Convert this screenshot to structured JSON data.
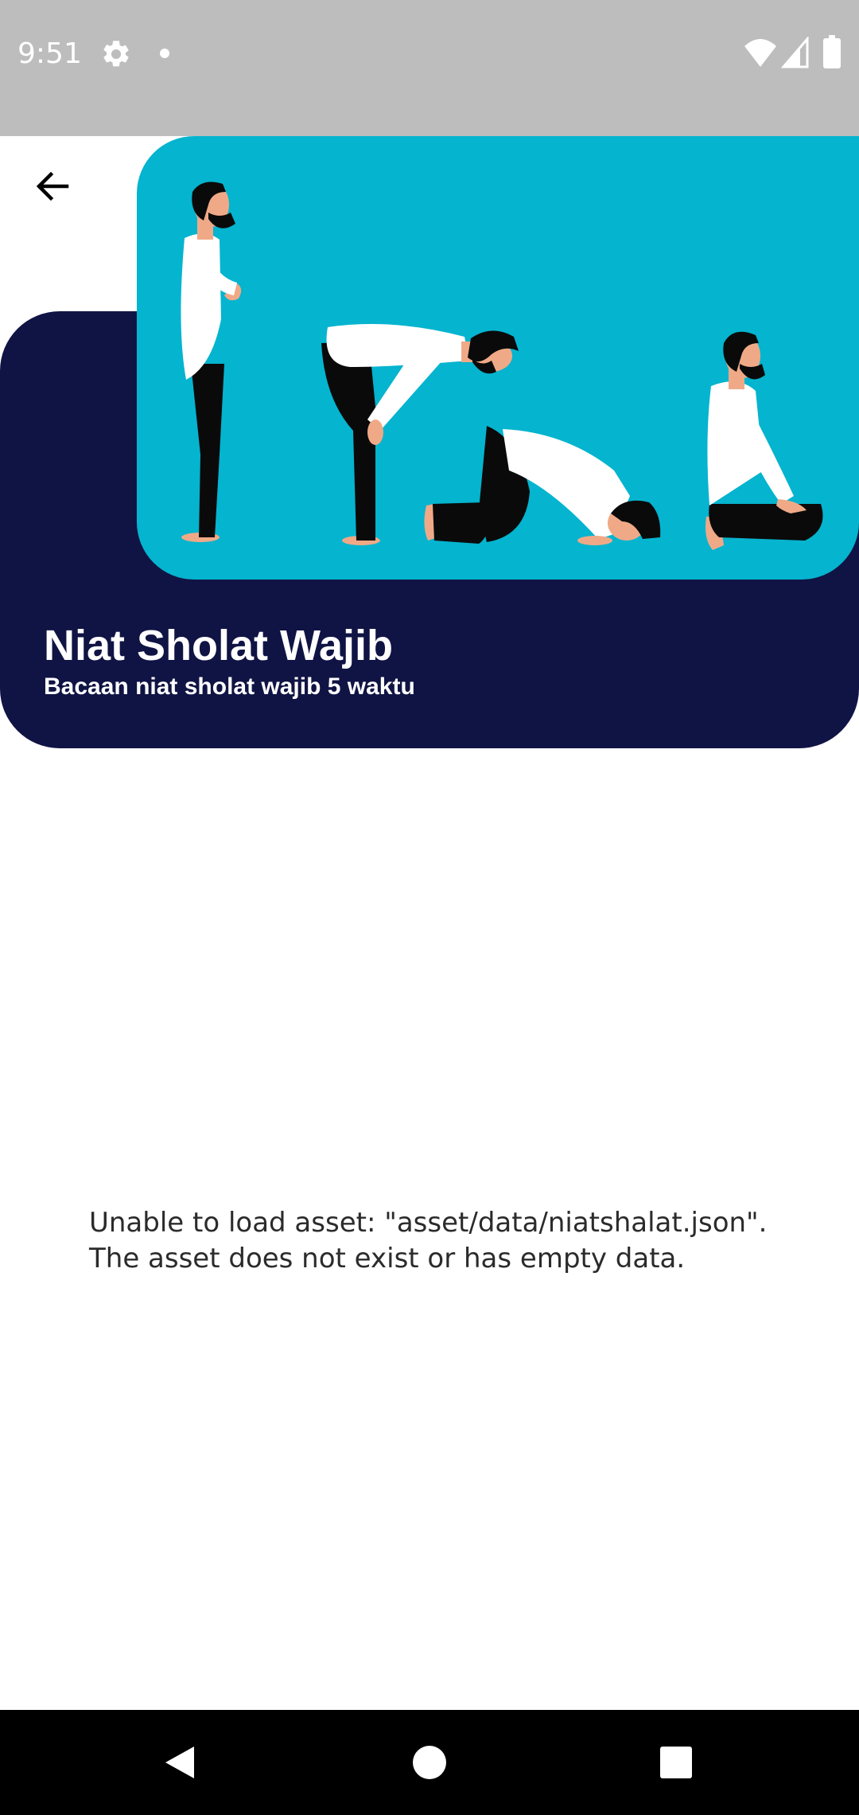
{
  "status_bar": {
    "time": "9:51",
    "icons": [
      "gear-icon",
      "dot-icon",
      "wifi-icon",
      "signal-icon",
      "battery-icon"
    ]
  },
  "header": {
    "back_icon": "arrow-left-icon",
    "title": "Niat Sholat Wajib",
    "subtitle": "Bacaan niat sholat wajib 5 waktu",
    "illustration": "prayer-positions-illustration"
  },
  "content": {
    "error_line_1": "Unable to load asset: \"asset/data/niatshalat.json\".",
    "error_line_2": "The asset does not exist or has empty data."
  },
  "nav_bar": {
    "buttons": [
      "back-triangle-icon",
      "home-circle-icon",
      "recents-square-icon"
    ]
  },
  "colors": {
    "status_bar": "#bdbdbd",
    "header_card": "#101444",
    "illustration_bg": "#05b4cf",
    "nav_bar": "#000000"
  }
}
